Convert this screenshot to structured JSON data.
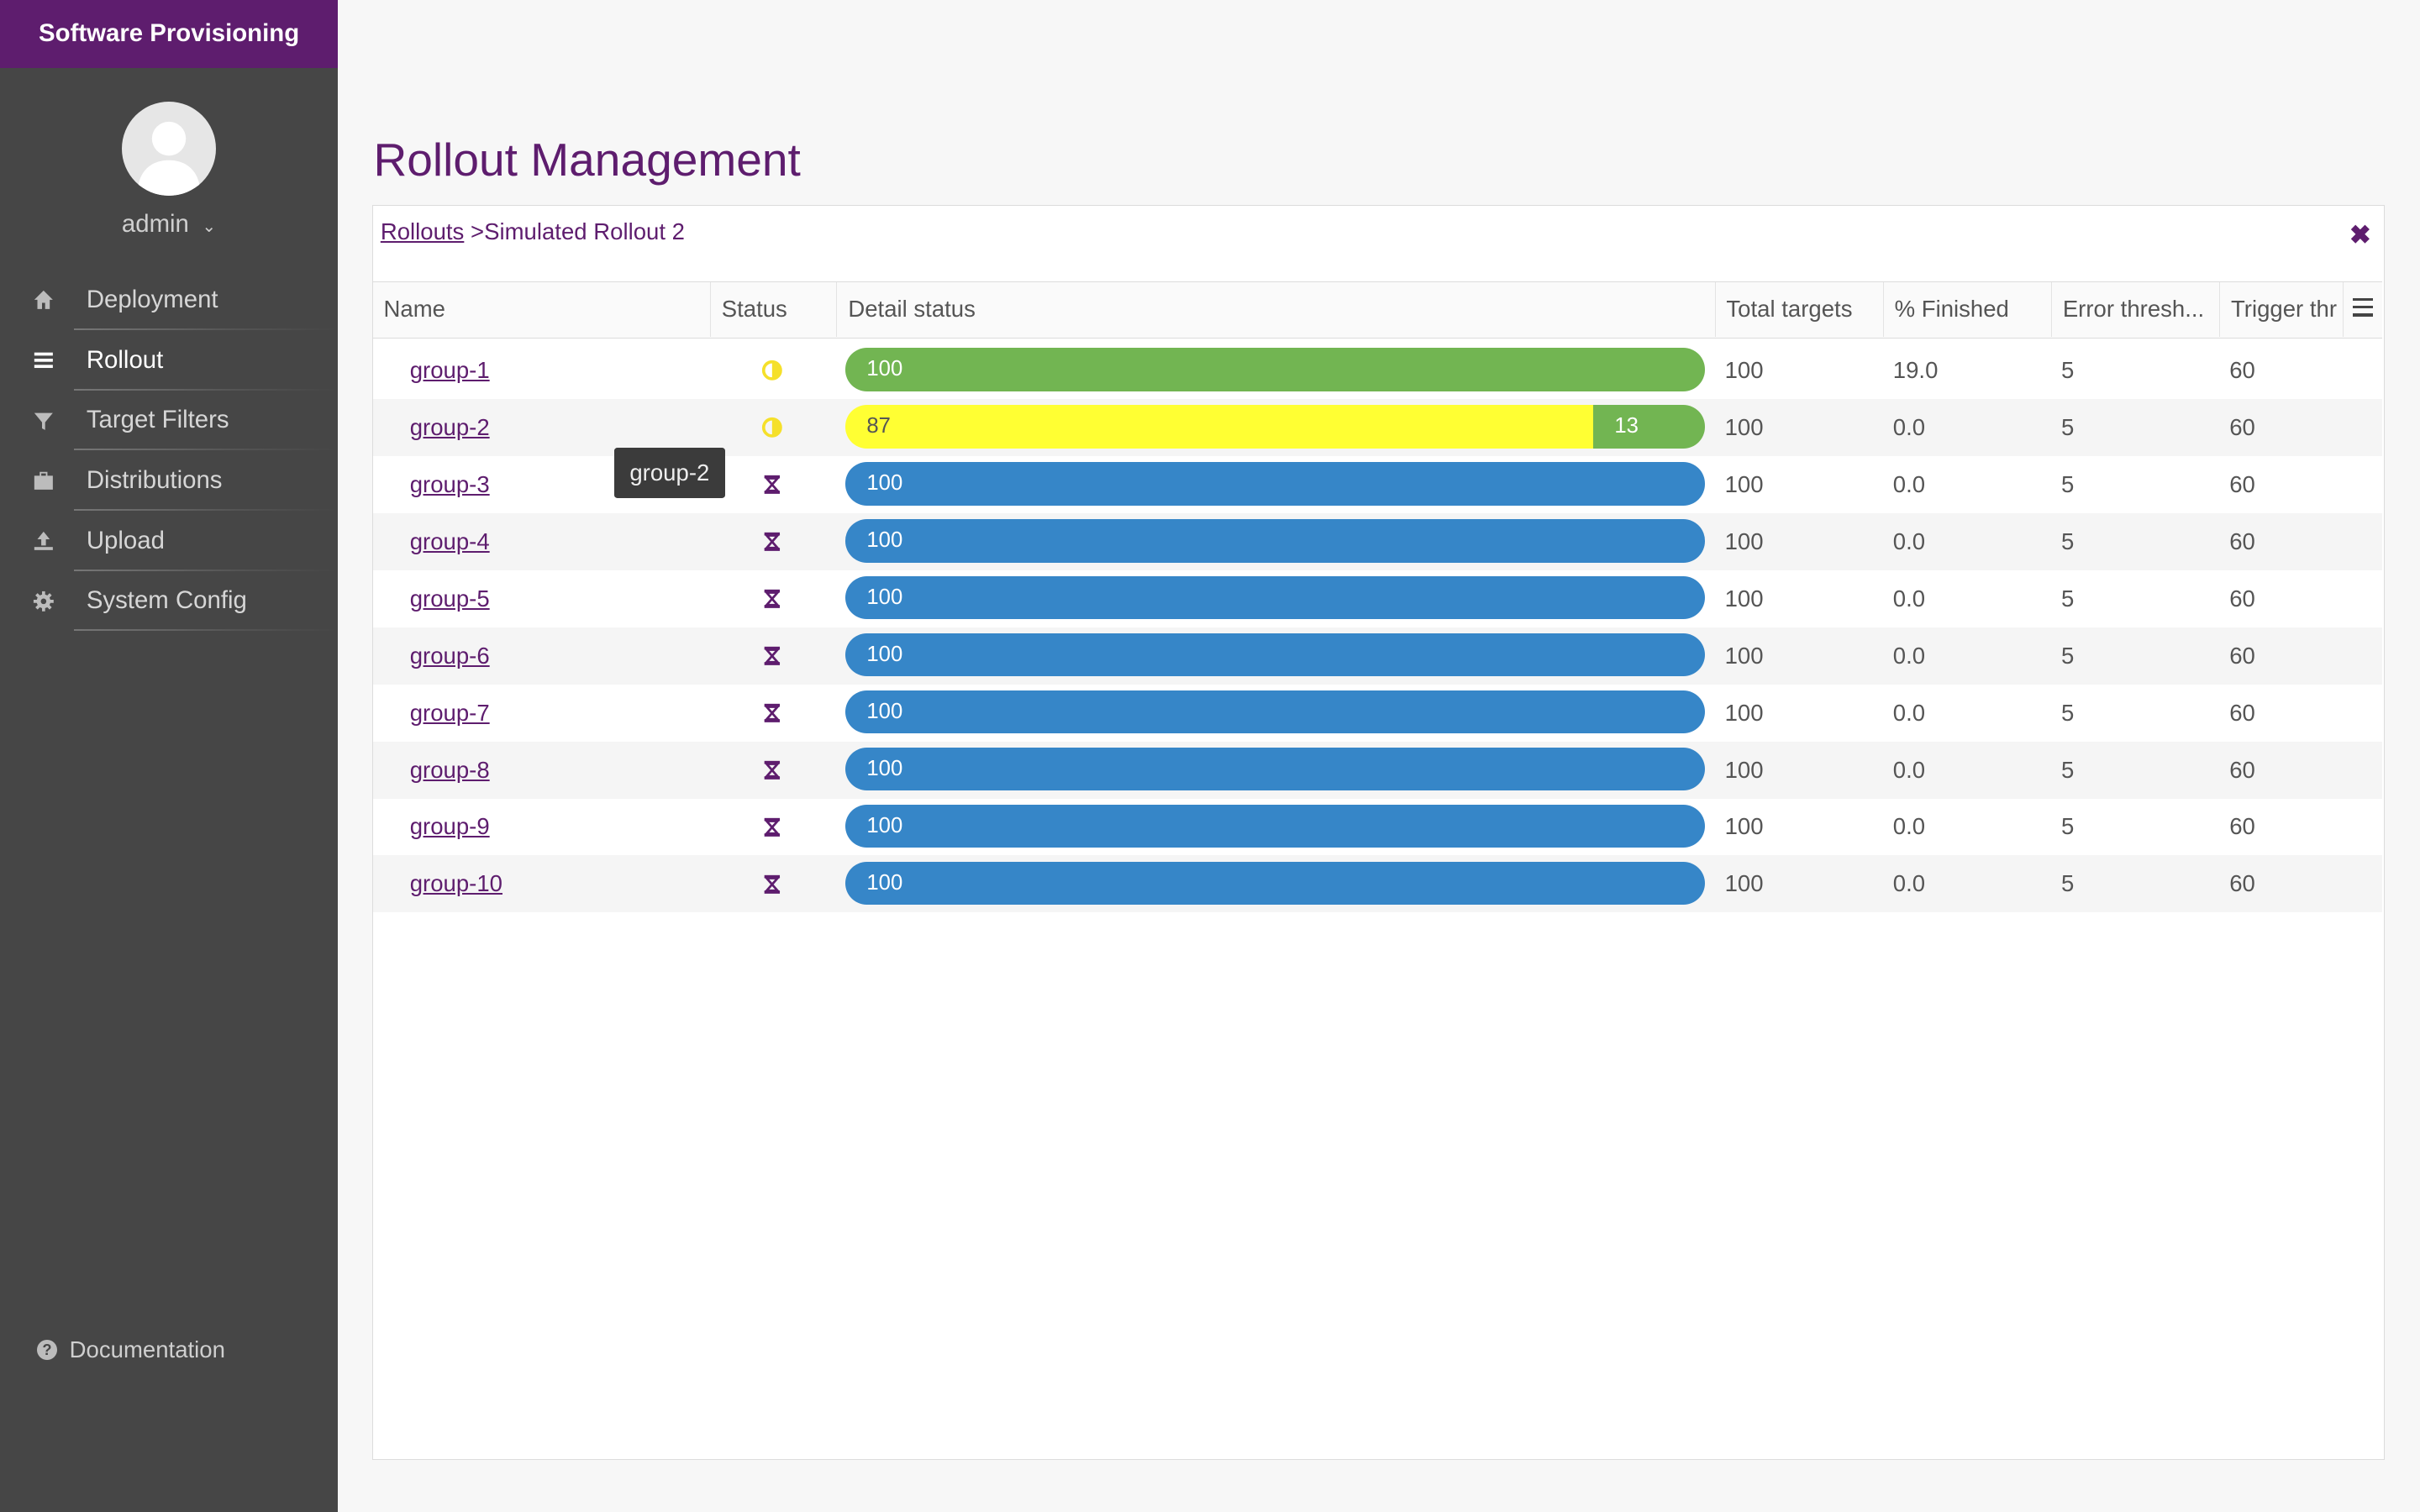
{
  "app": {
    "title": "Software Provisioning"
  },
  "user": {
    "name": "admin"
  },
  "nav": [
    {
      "label": "Deployment",
      "icon": "home-icon"
    },
    {
      "label": "Rollout",
      "icon": "list-icon",
      "active": true
    },
    {
      "label": "Target Filters",
      "icon": "filter-icon"
    },
    {
      "label": "Distributions",
      "icon": "briefcase-icon"
    },
    {
      "label": "Upload",
      "icon": "upload-icon"
    },
    {
      "label": "System Config",
      "icon": "gear-icon"
    }
  ],
  "footer": {
    "documentation": "Documentation"
  },
  "page": {
    "title": "Rollout Management"
  },
  "breadcrumb": {
    "root": "Rollouts",
    "separator": " >",
    "current": "Simulated Rollout 2"
  },
  "table": {
    "headers": [
      "Name",
      "Status",
      "Detail status",
      "Total targets",
      "% Finished",
      "Error thresh...",
      "Trigger thr"
    ],
    "rows": [
      {
        "name": "group-1",
        "status": "running",
        "detail": [
          {
            "value": "100",
            "color": "#72b552"
          }
        ],
        "total": "100",
        "finished": "19.0",
        "error": "5",
        "trigger": "60"
      },
      {
        "name": "group-2",
        "status": "running",
        "detail": [
          {
            "value": "87",
            "color": "#ffff33"
          },
          {
            "value": "13",
            "color": "#72b552"
          }
        ],
        "total": "100",
        "finished": "0.0",
        "error": "5",
        "trigger": "60"
      },
      {
        "name": "group-3",
        "status": "scheduled",
        "detail": [
          {
            "value": "100",
            "color": "#3686c8"
          }
        ],
        "total": "100",
        "finished": "0.0",
        "error": "5",
        "trigger": "60"
      },
      {
        "name": "group-4",
        "status": "scheduled",
        "detail": [
          {
            "value": "100",
            "color": "#3686c8"
          }
        ],
        "total": "100",
        "finished": "0.0",
        "error": "5",
        "trigger": "60"
      },
      {
        "name": "group-5",
        "status": "scheduled",
        "detail": [
          {
            "value": "100",
            "color": "#3686c8"
          }
        ],
        "total": "100",
        "finished": "0.0",
        "error": "5",
        "trigger": "60"
      },
      {
        "name": "group-6",
        "status": "scheduled",
        "detail": [
          {
            "value": "100",
            "color": "#3686c8"
          }
        ],
        "total": "100",
        "finished": "0.0",
        "error": "5",
        "trigger": "60"
      },
      {
        "name": "group-7",
        "status": "scheduled",
        "detail": [
          {
            "value": "100",
            "color": "#3686c8"
          }
        ],
        "total": "100",
        "finished": "0.0",
        "error": "5",
        "trigger": "60"
      },
      {
        "name": "group-8",
        "status": "scheduled",
        "detail": [
          {
            "value": "100",
            "color": "#3686c8"
          }
        ],
        "total": "100",
        "finished": "0.0",
        "error": "5",
        "trigger": "60"
      },
      {
        "name": "group-9",
        "status": "scheduled",
        "detail": [
          {
            "value": "100",
            "color": "#3686c8"
          }
        ],
        "total": "100",
        "finished": "0.0",
        "error": "5",
        "trigger": "60"
      },
      {
        "name": "group-10",
        "status": "scheduled",
        "detail": [
          {
            "value": "100",
            "color": "#3686c8"
          }
        ],
        "total": "100",
        "finished": "0.0",
        "error": "5",
        "trigger": "60"
      }
    ]
  },
  "tooltip": {
    "text": "group-2"
  },
  "colors": {
    "brand": "#5e1d6e",
    "sidebar": "#464646",
    "running": "#f5e02a",
    "scheduled": "#5e1d6e"
  }
}
